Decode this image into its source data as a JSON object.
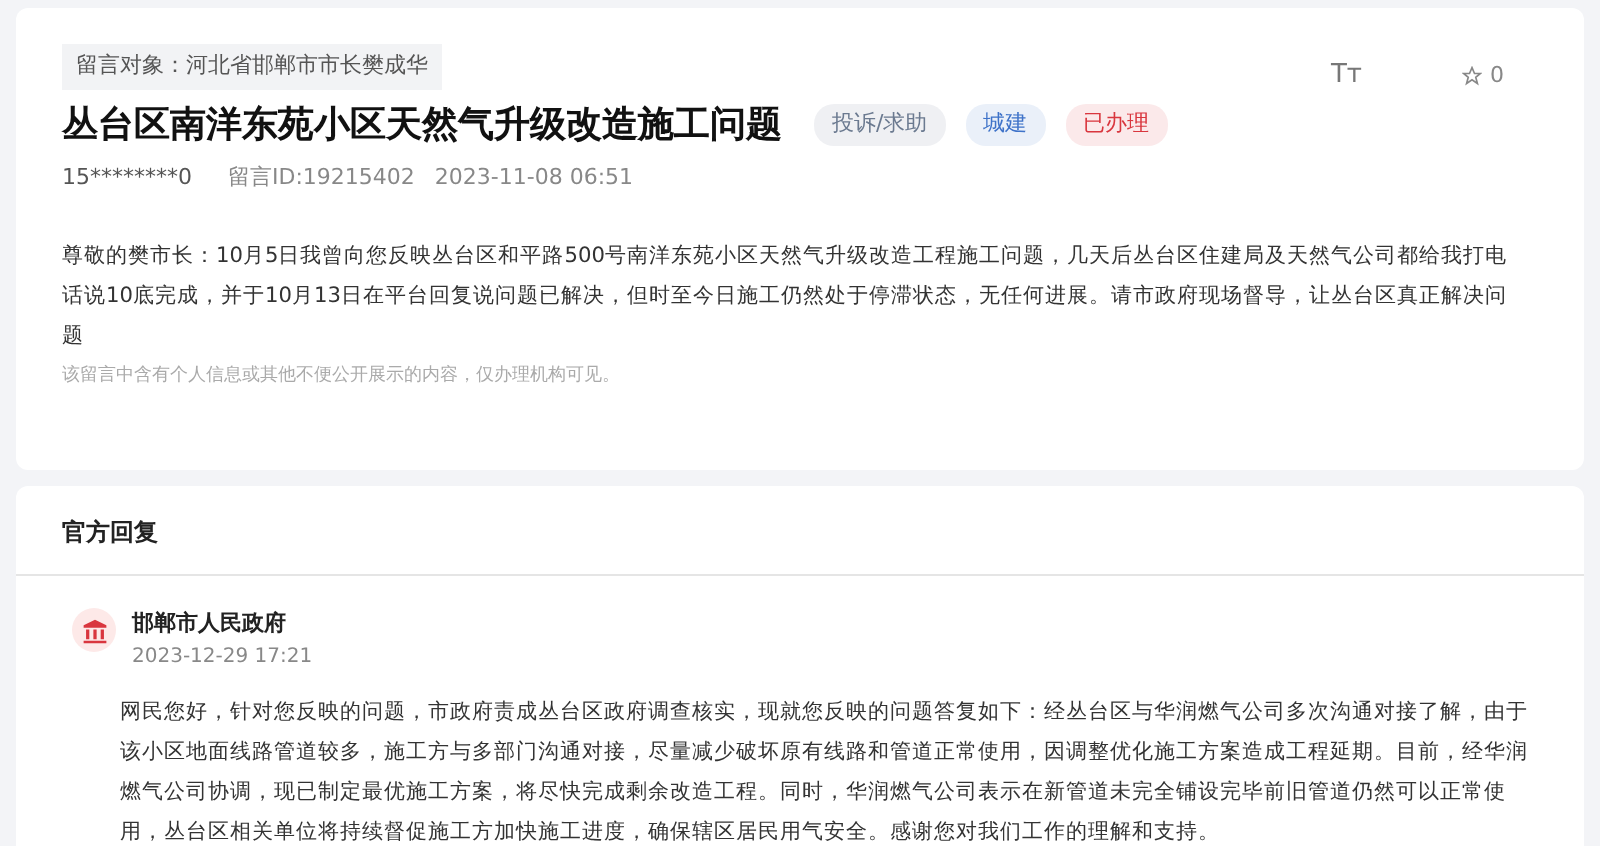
{
  "message": {
    "target": "留言对象：河北省邯郸市市长樊成华",
    "title": "丛台区南洋东苑小区天然气升级改造施工问题",
    "tags": [
      {
        "label": "投诉/求助",
        "color": "#6b7a90"
      },
      {
        "label": "城建",
        "color": "#3f73c9"
      },
      {
        "label": "已办理",
        "color": "#d9363e"
      }
    ],
    "font_toggle": "Tт",
    "star_count": "0",
    "author": "15********0",
    "message_id": "留言ID:19215402",
    "time": "2023-11-08 06:51",
    "body": "尊敬的樊市长：10月5日我曾向您反映丛台区和平路500号南洋东苑小区天然气升级改造工程施工问题，几天后丛台区住建局及天然气公司都给我打电话说10底完成，并于10月13日在平台回复说问题已解决，但时至今日施工仍然处于停滞状态，无任何进展。请市政府现场督导，让丛台区真正解决问题",
    "privacy_note": "该留言中含有个人信息或其他不便公开展示的内容，仅办理机构可见。"
  },
  "reply": {
    "heading": "官方回复",
    "org": "邯郸市人民政府",
    "time": "2023-12-29 17:21",
    "body": "网民您好，针对您反映的问题，市政府责成丛台区政府调查核实，现就您反映的问题答复如下：经丛台区与华润燃气公司多次沟通对接了解，由于该小区地面线路管道较多，施工方与多部门沟通对接，尽量减少破坏原有线路和管道正常使用，因调整优化施工方案造成工程延期。目前，经华润燃气公司协调，现已制定最优施工方案，将尽快完成剩余改造工程。同时，华润燃气公司表示在新管道未完全铺设完毕前旧管道仍然可以正常使用，丛台区相关单位将持续督促施工方加快施工进度，确保辖区居民用气安全。感谢您对我们工作的理解和支持。"
  }
}
